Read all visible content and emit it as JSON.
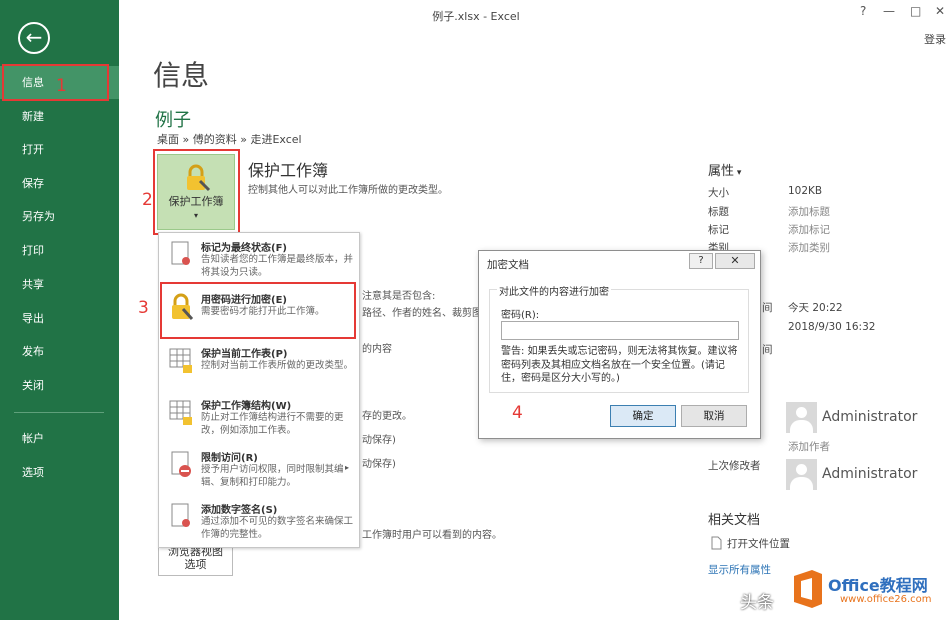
{
  "window": {
    "title": "例子.xlsx - Excel",
    "help": "?",
    "minimize": "—",
    "maximize": "□",
    "close": "✕",
    "login": "登录"
  },
  "sidebar": {
    "back": "←",
    "items": [
      "信息",
      "新建",
      "打开",
      "保存",
      "另存为",
      "打印",
      "共享",
      "导出",
      "发布",
      "关闭",
      "帐户",
      "选项"
    ],
    "annotation": "1"
  },
  "main": {
    "title": "信息",
    "file_name": "例子",
    "breadcrumb": "桌面 » 傅的资料 » 走进Excel",
    "protect_button": "保护工作簿",
    "protect_title": "保护工作簿",
    "protect_desc": "控制其他人可以对此工作簿所做的更改类型。",
    "annotation_2": "2",
    "annotation_3": "3",
    "annotation_4": "4",
    "bg_texts": [
      "注意其是否包含:",
      "路径、作者的姓名、裁剪图",
      "的内容",
      "存的更改。",
      "动保存)",
      "动保存)",
      "工作簿时用户可以看到的内容。"
    ],
    "view_button": "浏览器视图\n选项"
  },
  "menu": [
    {
      "title": "标记为最终状态(F)",
      "desc": "告知读者您的工作簿是最终版本，并将其设为只读。"
    },
    {
      "title": "用密码进行加密(E)",
      "desc": "需要密码才能打开此工作簿。"
    },
    {
      "title": "保护当前工作表(P)",
      "desc": "控制对当前工作表所做的更改类型。"
    },
    {
      "title": "保护工作簿结构(W)",
      "desc": "防止对工作簿结构进行不需要的更改，例如添加工作表。"
    },
    {
      "title": "限制访问(R)",
      "desc": "授予用户访问权限，同时限制其编辑、复制和打印能力。"
    },
    {
      "title": "添加数字签名(S)",
      "desc": "通过添加不可见的数字签名来确保工作簿的完整性。"
    }
  ],
  "props": {
    "title": "属性",
    "rows": [
      {
        "k": "大小",
        "v": "102KB"
      },
      {
        "k": "标题",
        "v": "添加标题"
      },
      {
        "k": "标记",
        "v": "添加标记"
      },
      {
        "k": "类别",
        "v": "添加类别"
      }
    ],
    "time_label1": "间",
    "time_val1": "今天 20:22",
    "time_val2": "2018/9/30 16:32",
    "time_label2": "间",
    "author": "Administrator",
    "add_author": "添加作者",
    "last_modified_label": "上次修改者",
    "last_modified": "Administrator",
    "related_title": "相关文档",
    "open_location": "打开文件位置",
    "show_all": "显示所有属性"
  },
  "dialog": {
    "title": "加密文档",
    "help": "?",
    "close": "✕",
    "group_label": "对此文件的内容进行加密",
    "password_label": "密码(R):",
    "password_value": "",
    "warning": "警告: 如果丢失或忘记密码，则无法将其恢复。建议将密码列表及其相应文档名放在一个安全位置。(请记住，密码是区分大小写的。)",
    "ok": "确定",
    "cancel": "取消"
  },
  "watermark": {
    "text": "头条",
    "brand": "Office教程网",
    "url": "www.office26.com"
  },
  "colors": {
    "excel_green": "#217346",
    "highlight_red": "#e53935",
    "selected_nav": "#439467"
  }
}
